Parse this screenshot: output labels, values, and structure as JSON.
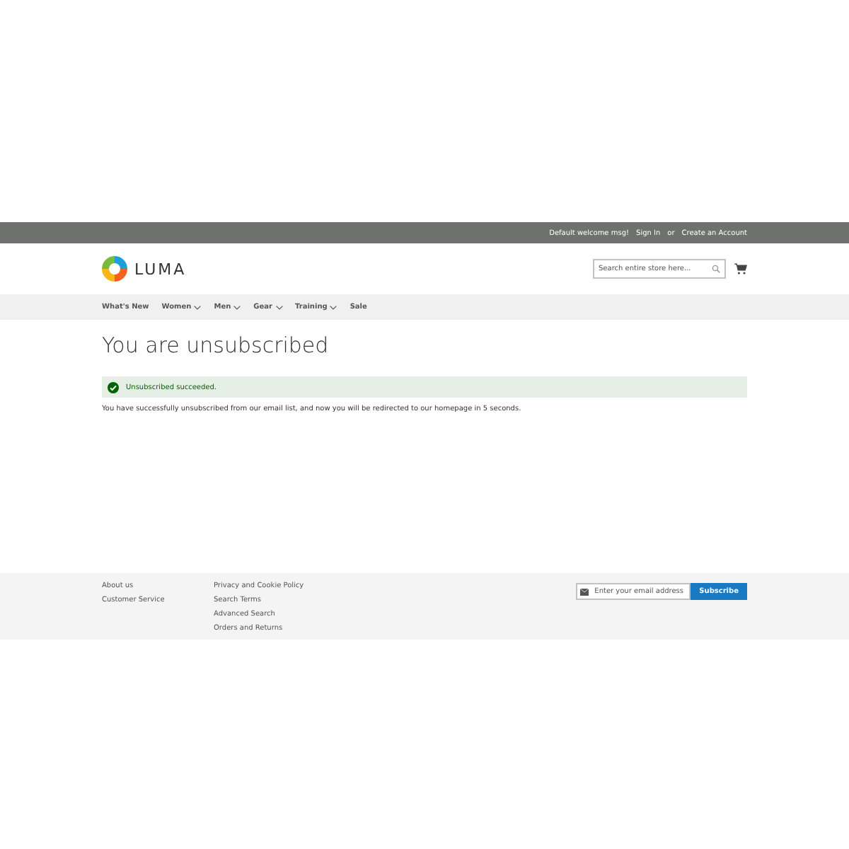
{
  "top_bar": {
    "welcome": "Default welcome msg!",
    "sign_in": "Sign In",
    "separator": "or",
    "create_account": "Create an Account"
  },
  "header": {
    "logo_text": "LUMA",
    "search": {
      "placeholder": "Search entire store here..."
    }
  },
  "nav": [
    {
      "label": "What's New",
      "has_dropdown": false
    },
    {
      "label": "Women",
      "has_dropdown": true
    },
    {
      "label": "Men",
      "has_dropdown": true
    },
    {
      "label": "Gear",
      "has_dropdown": true
    },
    {
      "label": "Training",
      "has_dropdown": true
    },
    {
      "label": "Sale",
      "has_dropdown": false
    }
  ],
  "page_title": "You are unsubscribed",
  "message": {
    "kind": "success",
    "text": "Unsubscribed succeeded."
  },
  "body_text": "You have successfully unsubscribed from our email list, and now you will be redirected to our homepage in 5 seconds.",
  "footer": {
    "columns": [
      [
        "About us",
        "Customer Service"
      ],
      [
        "Privacy and Cookie Policy",
        "Search Terms",
        "Advanced Search",
        "Orders and Returns"
      ]
    ],
    "newsletter": {
      "placeholder": "Enter your email address",
      "button": "Subscribe"
    }
  }
}
